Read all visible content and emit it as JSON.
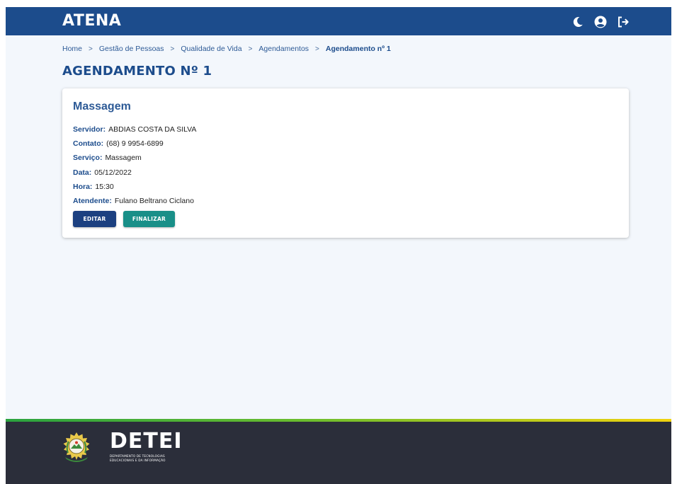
{
  "app": {
    "brand": "ATENA"
  },
  "header": {
    "icons": [
      "moon-icon",
      "user-circle-icon",
      "logout-icon"
    ]
  },
  "breadcrumb": {
    "items": [
      "Home",
      "Gestão de Pessoas",
      "Qualidade de Vida",
      "Agendamentos"
    ],
    "current": "Agendamento nº 1",
    "separator": ">"
  },
  "page": {
    "title": "AGENDAMENTO Nº 1"
  },
  "card": {
    "title": "Massagem",
    "fields": [
      {
        "label": "Servidor:",
        "value": "ABDIAS COSTA DA SILVA"
      },
      {
        "label": "Contato:",
        "value": "(68) 9 9954-6899"
      },
      {
        "label": "Serviço:",
        "value": "Massagem"
      },
      {
        "label": "Data:",
        "value": "05/12/2022"
      },
      {
        "label": "Hora:",
        "value": "15:30"
      },
      {
        "label": "Atendente:",
        "value": "Fulano Beltrano Ciclano"
      }
    ],
    "buttons": {
      "edit": "EDITAR",
      "finish": "FINALIZAR"
    }
  },
  "footer": {
    "brand": "DETEI",
    "subtitle_line1": "DEPARTAMENTO DE TECNOLOGIAS",
    "subtitle_line2": "EDUCACIONAIS E DA INFORMAÇÃO"
  },
  "colors": {
    "primary": "#1c4c8c",
    "teal": "#198f88",
    "footer_bg": "#2b2e3a",
    "page_bg": "#f3f7fc"
  }
}
